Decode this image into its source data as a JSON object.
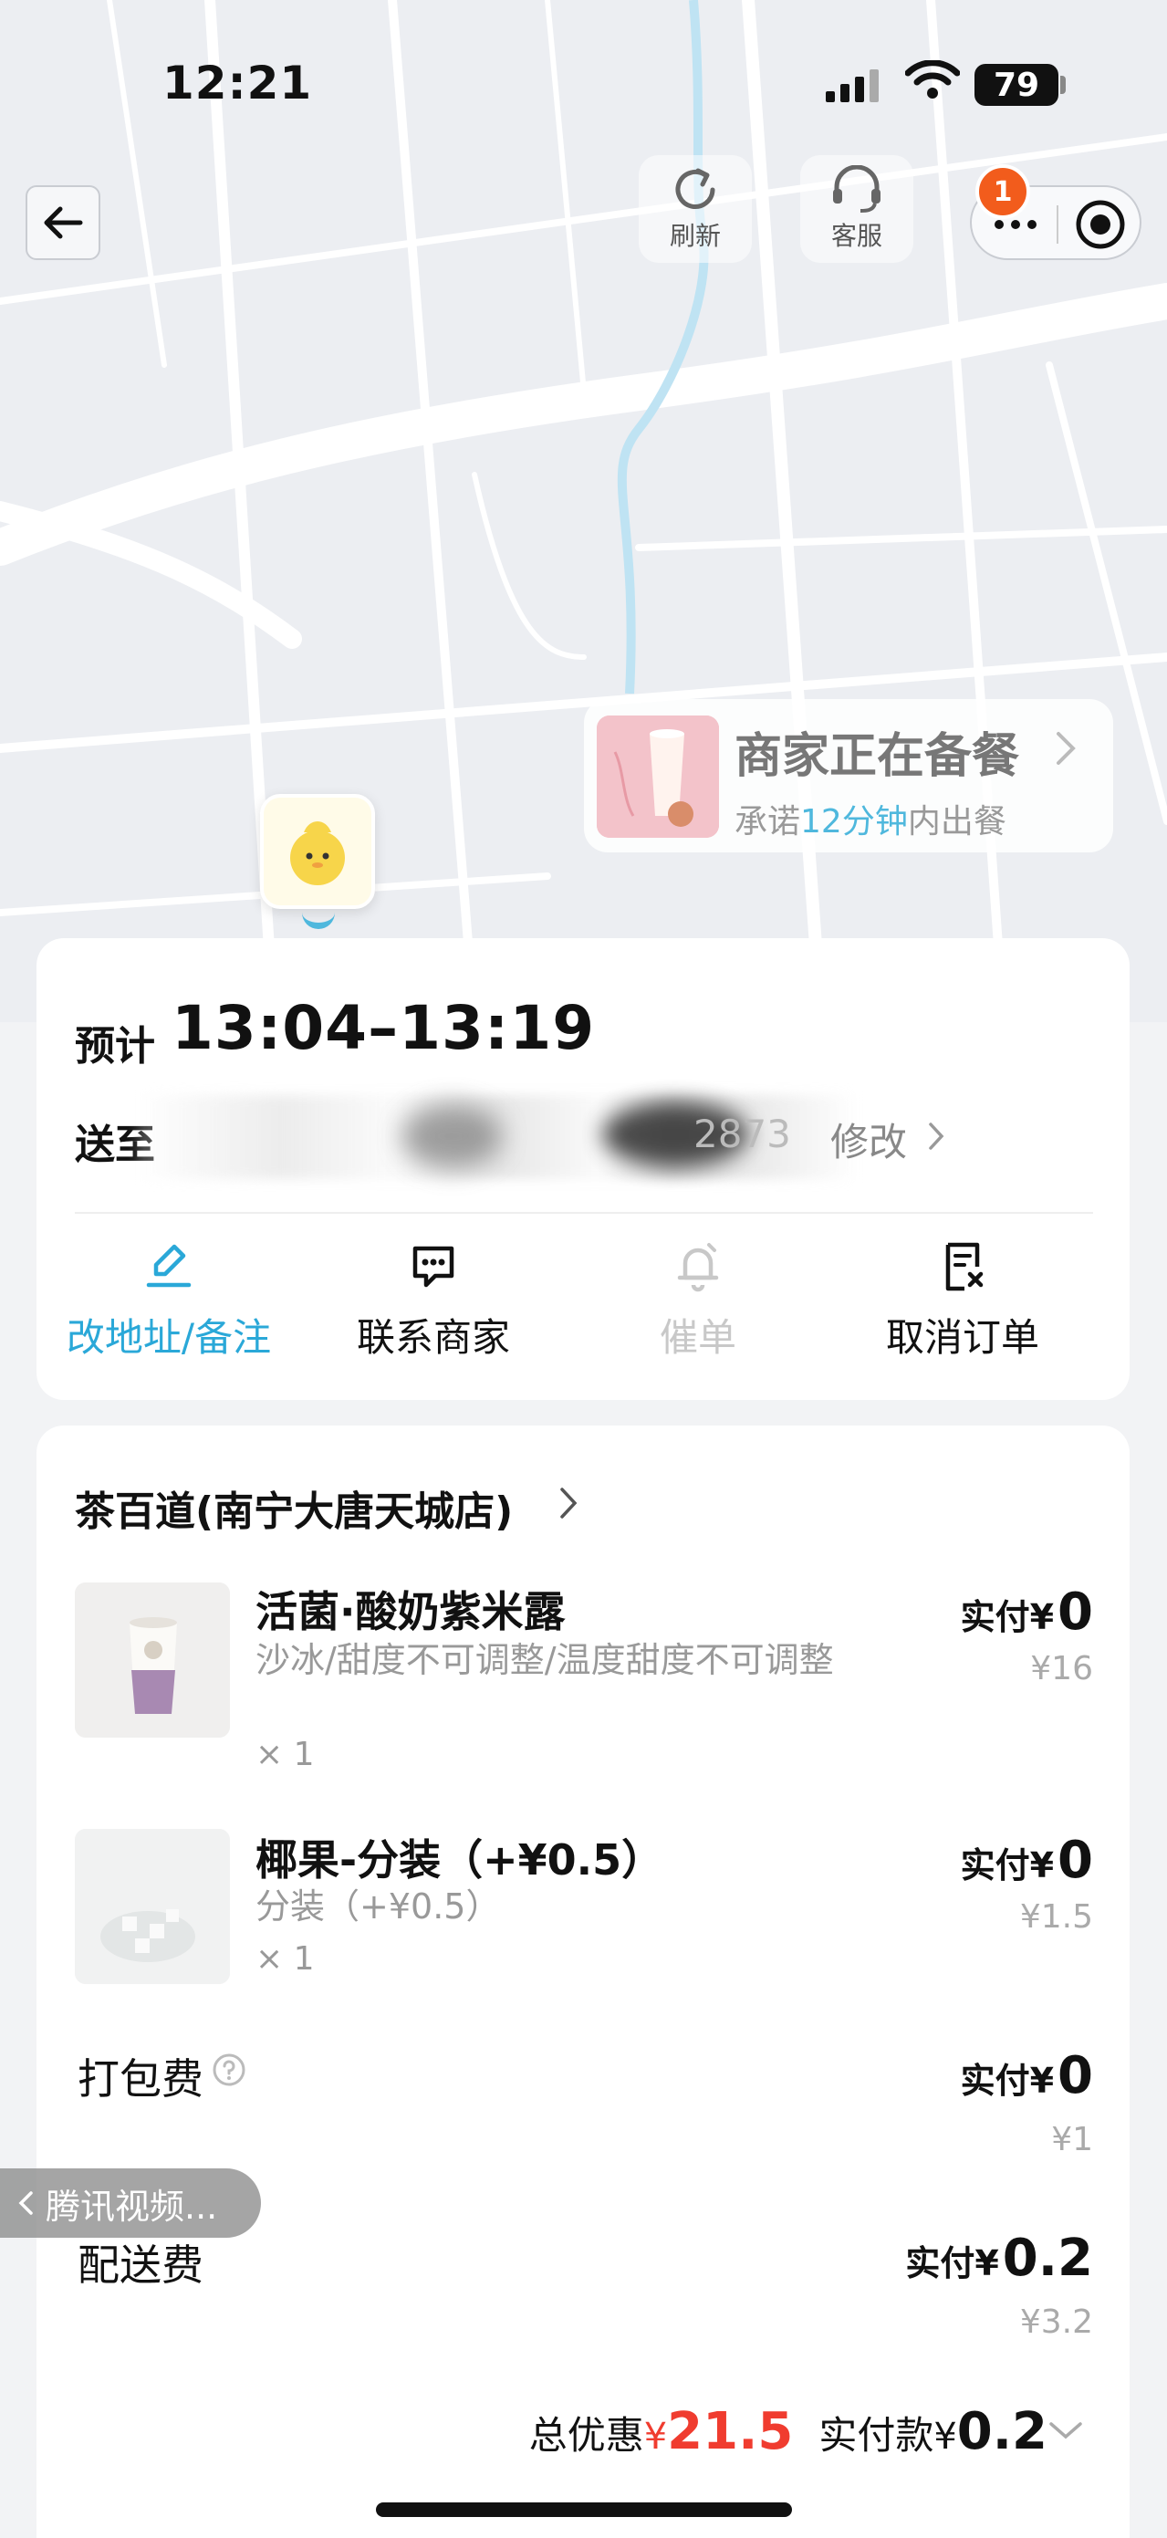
{
  "status_bar": {
    "time": "12:21",
    "battery": "79"
  },
  "nav": {
    "refresh_label": "刷新",
    "service_label": "客服",
    "notification_count": "1"
  },
  "merchant_bubble": {
    "status": "商家正在备餐",
    "promise_prefix": "承诺",
    "promise_highlight": "12分钟",
    "promise_suffix": "内出餐"
  },
  "delivery": {
    "eta_label": "预计",
    "eta_time": "13:04–13:19",
    "address_label": "送至",
    "address_tail": "2873",
    "edit_label": "修改",
    "actions": [
      {
        "label": "改地址/备注",
        "icon": "edit-address-icon",
        "color": "#2aa8d8"
      },
      {
        "label": "联系商家",
        "icon": "chat-icon",
        "color": "#111111"
      },
      {
        "label": "催单",
        "icon": "bell-icon",
        "color": "#c8c8c8"
      },
      {
        "label": "取消订单",
        "icon": "cancel-order-icon",
        "color": "#111111"
      }
    ]
  },
  "order": {
    "store_name": "茶百道(南宁大唐天城店)",
    "items": [
      {
        "name": "活菌·酸奶紫米露",
        "spec": "沙冰/甜度不可调整/温度甜度不可调整",
        "qty": "× 1",
        "paid_label": "实付",
        "currency": "¥",
        "paid": "0",
        "original": "¥16"
      },
      {
        "name": "椰果-分装（+¥0.5）",
        "spec": "分装（+¥0.5）",
        "qty": "× 1",
        "paid_label": "实付",
        "currency": "¥",
        "paid": "0",
        "original": "¥1.5"
      }
    ],
    "fees": [
      {
        "label": "打包费",
        "paid_label": "实付",
        "currency": "¥",
        "paid": "0",
        "original": "¥1"
      },
      {
        "label": "配送费",
        "paid_label": "实付",
        "currency": "¥",
        "paid": "0.2",
        "original": "¥3.2"
      }
    ],
    "summary": {
      "discount_label": "总优惠",
      "currency": "¥",
      "discount": "21.5",
      "paid_label": "实付款",
      "paid": "0.2"
    }
  },
  "back_to_app": {
    "label": "腾讯视频..."
  },
  "colors": {
    "accent": "#2aa8d8",
    "discount": "#f03c2f",
    "badge": "#f25c1c"
  }
}
